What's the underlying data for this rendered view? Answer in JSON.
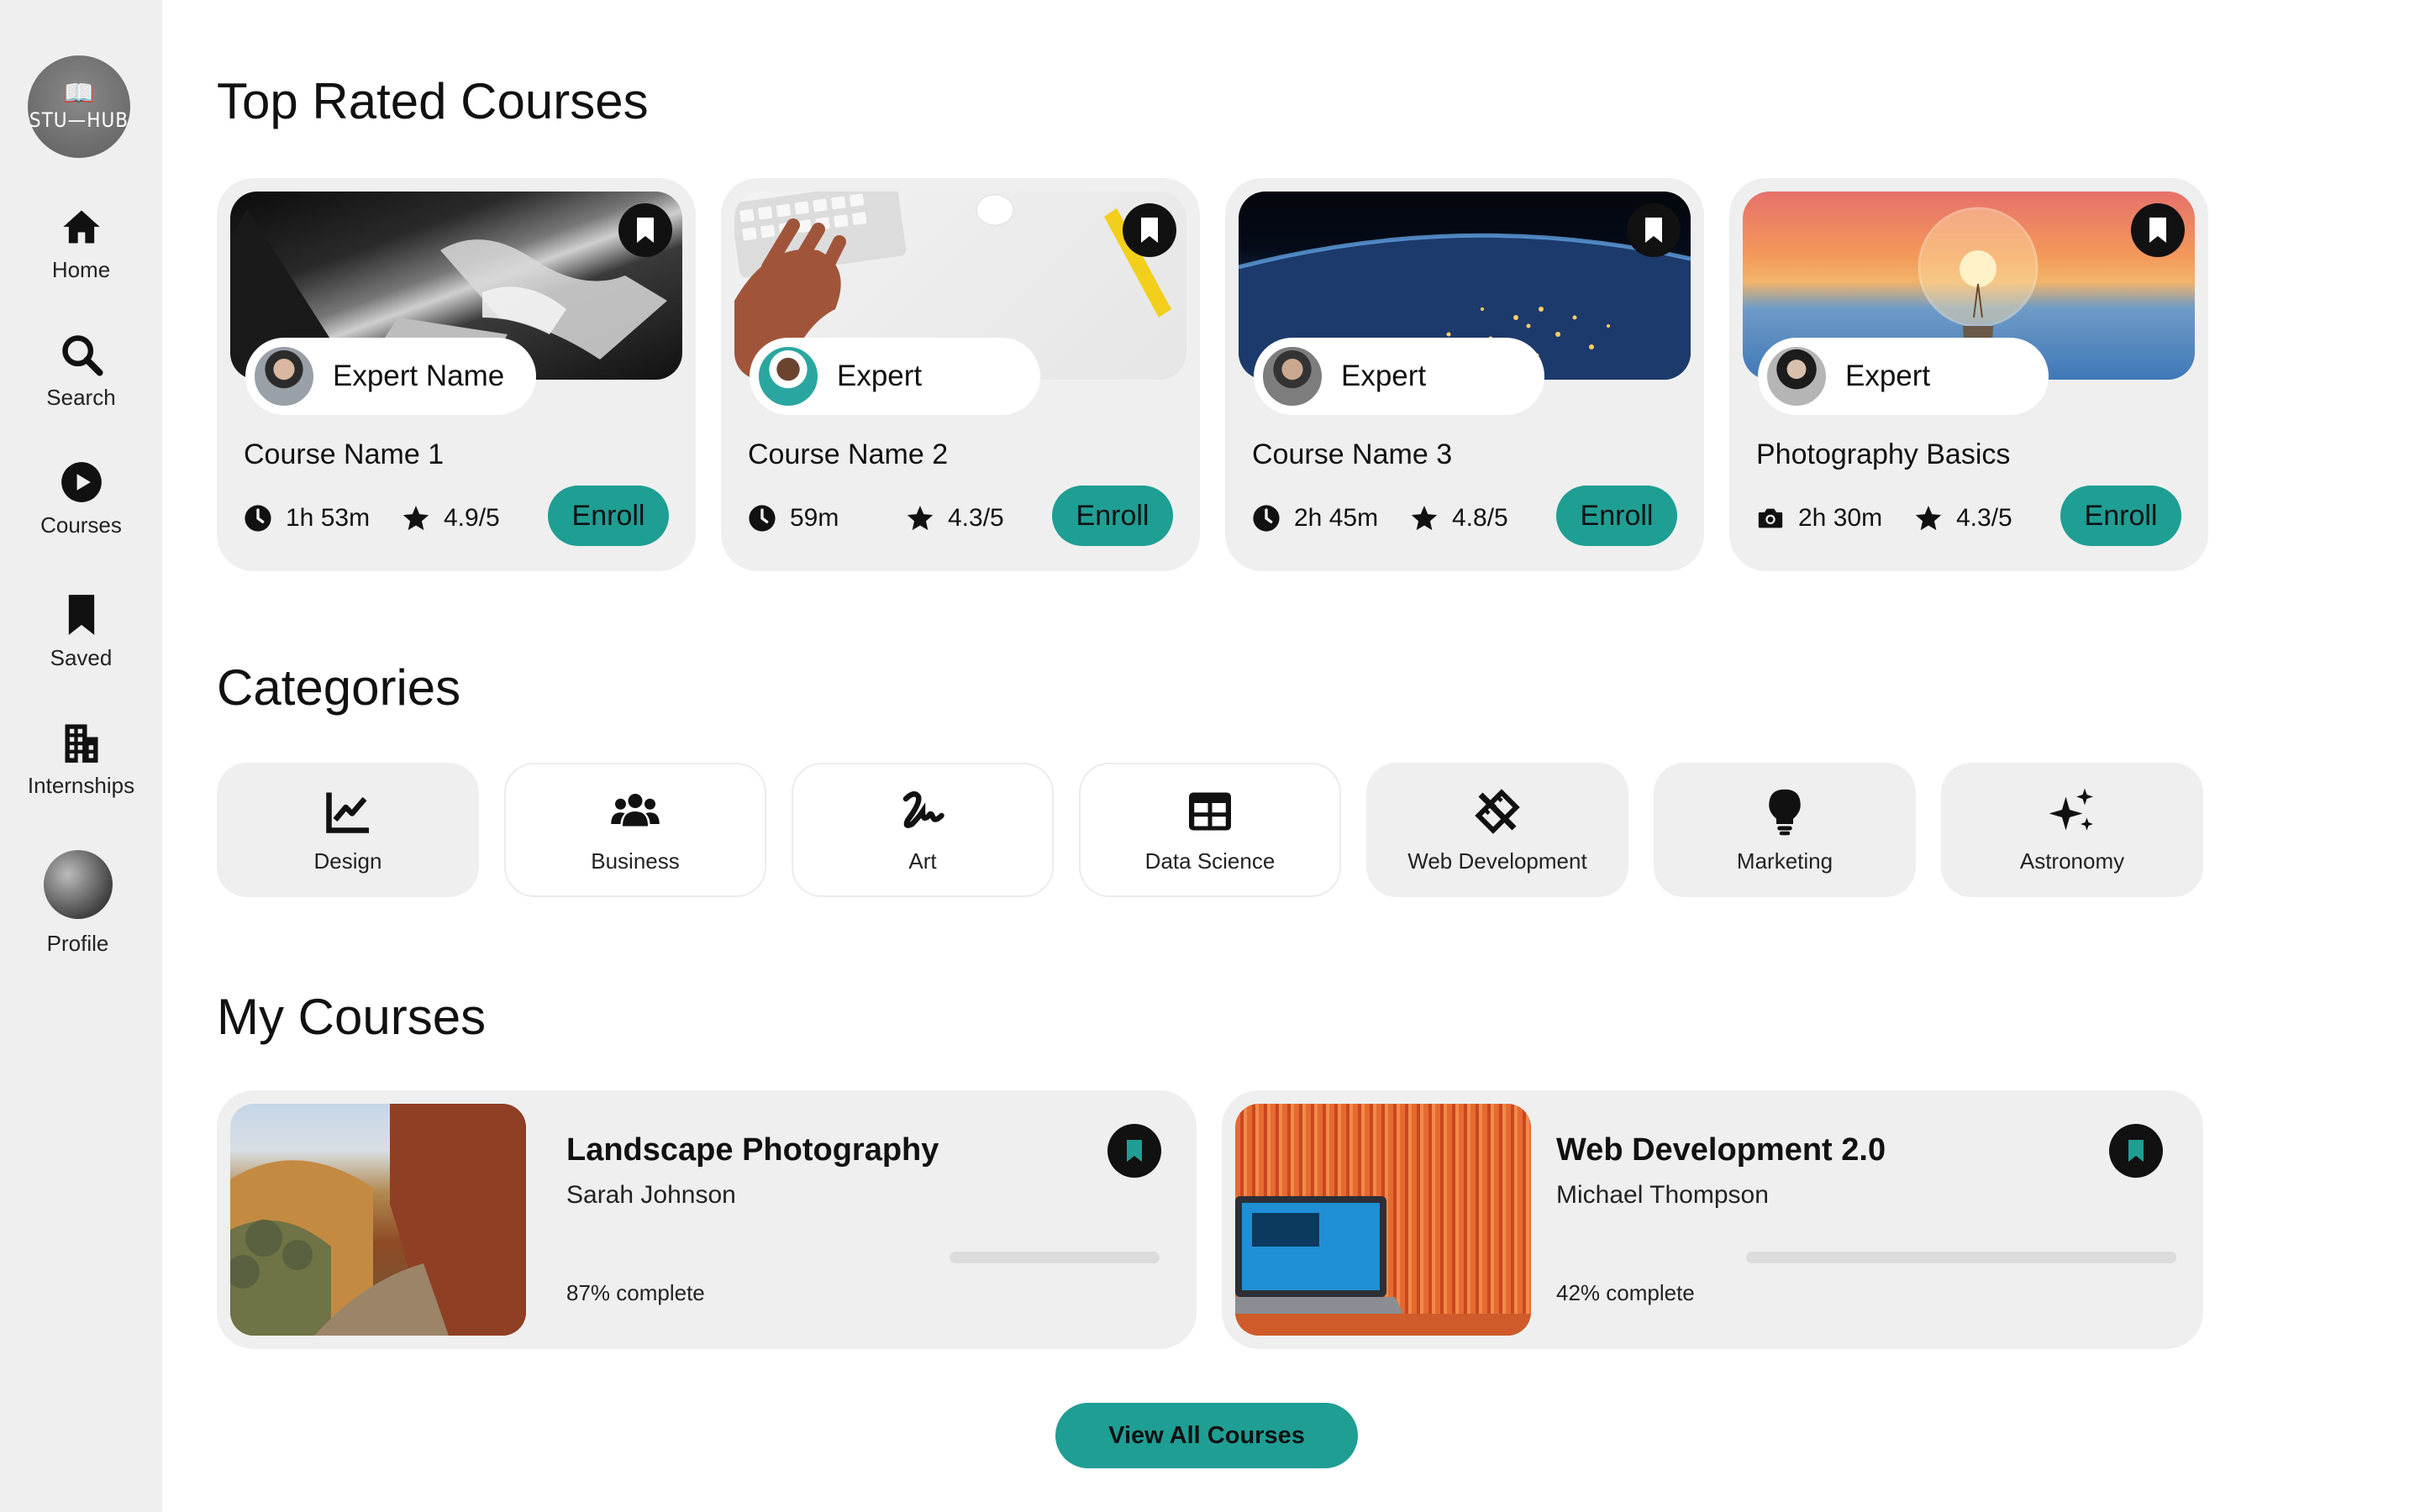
{
  "brand": {
    "logo_text": "STU—HUB",
    "teal": "#1f9e94"
  },
  "sidebar": {
    "items": [
      {
        "label": "Home",
        "icon": "home-icon"
      },
      {
        "label": "Search",
        "icon": "search-icon"
      },
      {
        "label": "Courses",
        "icon": "play-circle-icon"
      },
      {
        "label": "Saved",
        "icon": "bookmark-icon"
      },
      {
        "label": "Internships",
        "icon": "building-icon"
      },
      {
        "label": "Profile",
        "icon": "avatar"
      }
    ]
  },
  "top_rated": {
    "title": "Top Rated Courses",
    "courses": [
      {
        "expert": "Expert Name",
        "name": "Course Name 1",
        "duration": "1h 53m",
        "duration_icon": "clock-icon",
        "rating": "4.9/5",
        "enroll": "Enroll"
      },
      {
        "expert": "Expert",
        "name": "Course Name 2",
        "duration": "59m",
        "duration_icon": "clock-icon",
        "rating": "4.3/5",
        "enroll": "Enroll"
      },
      {
        "expert": "Expert",
        "name": "Course Name 3",
        "duration": "2h 45m",
        "duration_icon": "clock-icon",
        "rating": "4.8/5",
        "enroll": "Enroll"
      },
      {
        "expert": "Expert",
        "name": "Photography Basics",
        "duration": "2h 30m",
        "duration_icon": "camera-icon",
        "rating": "4.3/5",
        "enroll": "Enroll"
      }
    ]
  },
  "categories": {
    "title": "Categories",
    "items": [
      {
        "label": "Design",
        "icon": "chart-line-icon"
      },
      {
        "label": "Business",
        "icon": "users-icon"
      },
      {
        "label": "Art",
        "icon": "signature-icon"
      },
      {
        "label": "Data Science",
        "icon": "table-icon"
      },
      {
        "label": "Web Development",
        "icon": "tools-icon"
      },
      {
        "label": "Marketing",
        "icon": "lightbulb-icon"
      },
      {
        "label": "Astronomy",
        "icon": "sparkles-icon"
      }
    ]
  },
  "my_courses": {
    "title": "My Courses",
    "items": [
      {
        "title": "Landscape Photography",
        "author": "Sarah Johnson",
        "progress_text": "87% complete",
        "progress": 0.87
      },
      {
        "title": "Web Development 2.0",
        "author": "Michael Thompson",
        "progress_text": "42% complete",
        "progress": 0.42
      }
    ],
    "view_all": "View All Courses"
  }
}
